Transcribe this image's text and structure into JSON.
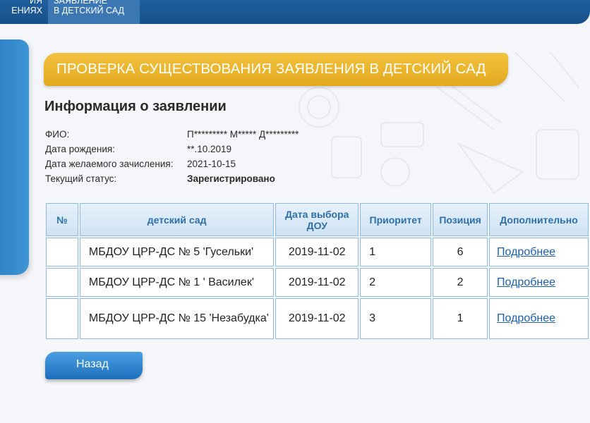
{
  "nav": {
    "items": [
      {
        "line1": "ИЯ",
        "line2": "ЕНИЯХ"
      },
      {
        "line1": "ЗАЯВЛЕНИЕ",
        "line2": "В ДЕТСКИЙ САД"
      }
    ]
  },
  "banner": {
    "title": "ПРОВЕРКА СУЩЕСТВОВАНИЯ ЗАЯВЛЕНИЯ В ДЕТСКИЙ САД"
  },
  "section_title": "Информация о заявлении",
  "info": [
    {
      "label": "ФИО:",
      "value": "П********* М***** Д*********",
      "bold": false
    },
    {
      "label": "Дата рождения:",
      "value": "**.10.2019",
      "bold": false
    },
    {
      "label": "Дата желаемого зачисления:",
      "value": "2021-10-15",
      "bold": false
    },
    {
      "label": "Текущий статус:",
      "value": "Зарегистрировано",
      "bold": true
    }
  ],
  "table": {
    "headers": {
      "num": "№",
      "kindergarten": "детский сад",
      "date": "Дата выбора ДОУ",
      "priority": "Приоритет",
      "position": "Позиция",
      "more": "Дополнительно"
    },
    "rows": [
      {
        "num": "",
        "kindergarten": "МБДОУ ЦРР-ДС № 5 'Гусельки'",
        "date": "2019-11-02",
        "priority": "1",
        "position": "6",
        "more": "Подробнее"
      },
      {
        "num": "",
        "kindergarten": "МБДОУ ЦРР-ДС № 1 ' Василек'",
        "date": "2019-11-02",
        "priority": "2",
        "position": "2",
        "more": "Подробнее"
      },
      {
        "num": "",
        "kindergarten": "МБДОУ ЦРР-ДС № 15 'Незабудка'",
        "date": "2019-11-02",
        "priority": "3",
        "position": "1",
        "more": "Подробнее"
      }
    ]
  },
  "back_button": {
    "label": "Назад"
  },
  "colors": {
    "nav_bg": "#1f5f9e",
    "banner": "#e8b12a",
    "table_border": "#8fb8dd",
    "header_text": "#2f6fa8",
    "link": "#1e5fa8"
  }
}
